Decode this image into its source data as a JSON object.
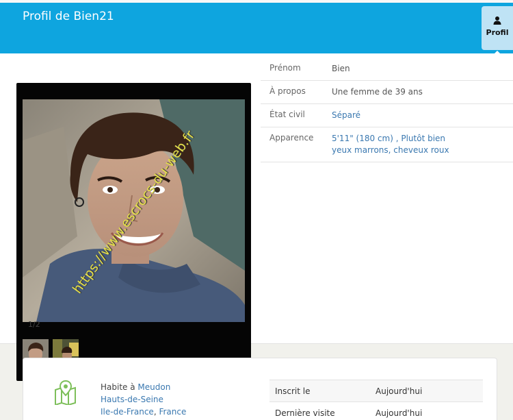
{
  "header": {
    "title": "Profil de Bien21",
    "profile_button_label": "Profil"
  },
  "gallery": {
    "counter": "1/2",
    "watermark": "https://www.escrocs-du-web.fr"
  },
  "details": [
    {
      "key": "Prénom",
      "value": "Bien"
    },
    {
      "key": "À propos",
      "value": "Une femme de 39 ans"
    },
    {
      "key": "État civil",
      "value": "Séparé"
    },
    {
      "key": "Apparence",
      "line1": "5'11\" (180 cm) , Plutôt bien",
      "line2": "yeux marrons, cheveux roux"
    }
  ],
  "location": {
    "prefix": "Habite à",
    "city": "Meudon",
    "department": "Hauts-de-Seine",
    "region": "Ile-de-France",
    "country": "France"
  },
  "stats": [
    {
      "key": "Inscrit le",
      "value": "Aujourd'hui"
    },
    {
      "key": "Dernière visite",
      "value": "Aujourd'hui"
    }
  ],
  "colors": {
    "header_blue": "#0ea5df",
    "link_blue": "#3a78b0",
    "watermark_yellow": "#e6e04a",
    "map_icon_green": "#7dbf5a"
  }
}
